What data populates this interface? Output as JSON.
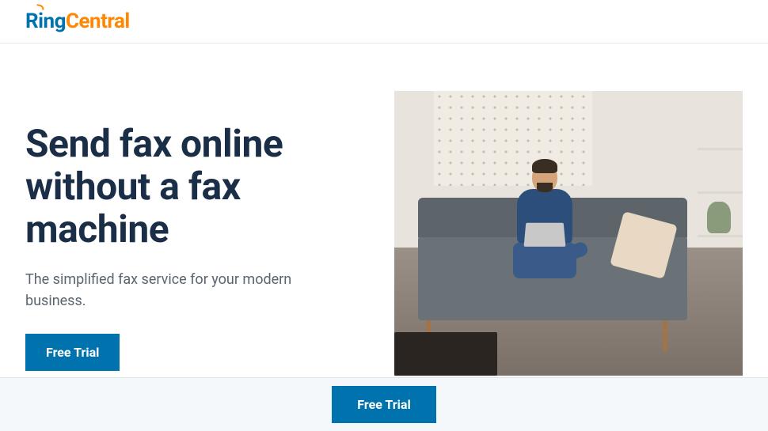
{
  "logo": {
    "part1": "R",
    "part2": "ng",
    "i_char": "i",
    "part3": "Central"
  },
  "hero": {
    "headline": "Send fax online without a fax machine",
    "subheadline": "The simplified fax service for your modern business.",
    "cta_label": "Free Trial"
  },
  "sticky": {
    "cta_label": "Free Trial"
  },
  "colors": {
    "brand_blue": "#0073ae",
    "brand_orange": "#ff8800",
    "headline_navy": "#1a2e47"
  }
}
